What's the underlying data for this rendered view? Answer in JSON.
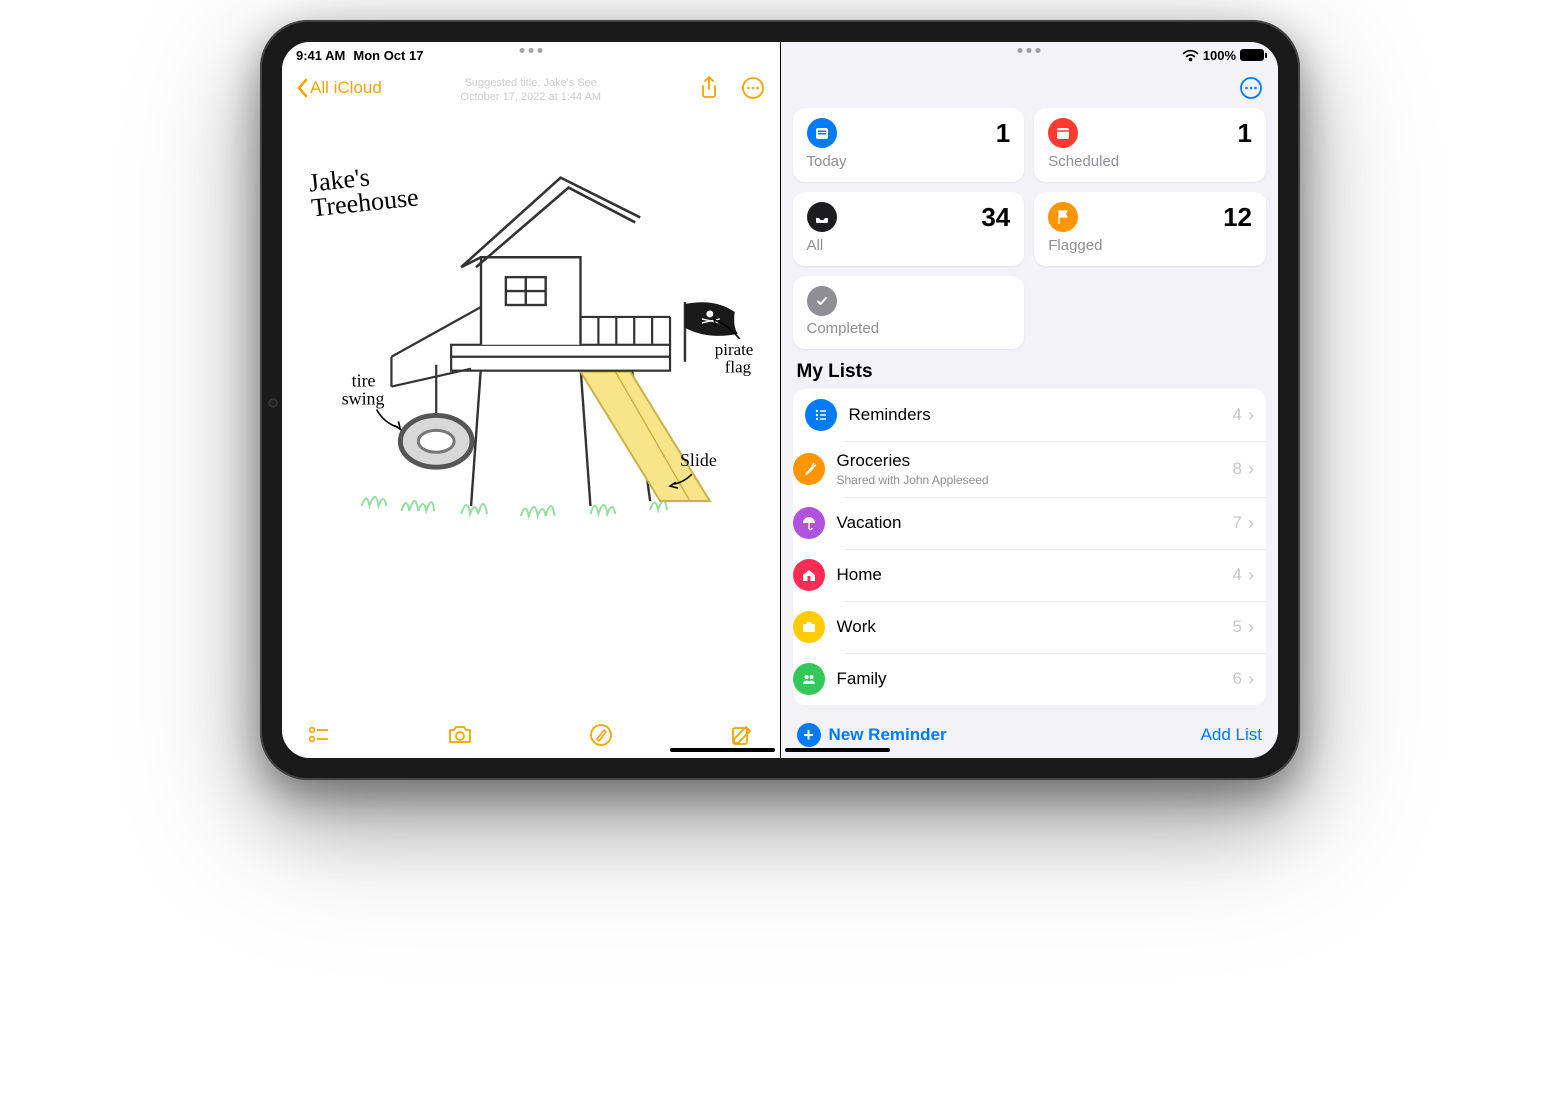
{
  "status": {
    "time": "9:41 AM",
    "date": "Mon Oct 17",
    "battery_pct": "100%"
  },
  "notes": {
    "back_label": "All iCloud",
    "suggested_line1": "Suggested title: Jake's  See",
    "suggested_line2": "October 17, 2022 at 1:44 AM",
    "sketch_title_line1": "Jake's",
    "sketch_title_line2": "Treehouse",
    "label_tire_swing": "tire\nswing",
    "label_pirate_flag": "pirate\nflag",
    "label_slide": "Slide"
  },
  "reminders": {
    "cards": {
      "today": {
        "label": "Today",
        "count": "1",
        "color": "#007aff"
      },
      "scheduled": {
        "label": "Scheduled",
        "count": "1",
        "color": "#ff3b30"
      },
      "all": {
        "label": "All",
        "count": "34",
        "color": "#1c1c1e"
      },
      "flagged": {
        "label": "Flagged",
        "count": "12",
        "color": "#ff9500"
      },
      "completed": {
        "label": "Completed",
        "count": "",
        "color": "#8e8e93"
      }
    },
    "my_lists_title": "My Lists",
    "lists": [
      {
        "name": "Reminders",
        "sub": "",
        "count": "4",
        "color": "#007aff",
        "icon": "list"
      },
      {
        "name": "Groceries",
        "sub": "Shared with John Appleseed",
        "count": "8",
        "color": "#ff9500",
        "icon": "carrot"
      },
      {
        "name": "Vacation",
        "sub": "",
        "count": "7",
        "color": "#af52de",
        "icon": "umbrella"
      },
      {
        "name": "Home",
        "sub": "",
        "count": "4",
        "color": "#ff2d55",
        "icon": "house"
      },
      {
        "name": "Work",
        "sub": "",
        "count": "5",
        "color": "#ffcc00",
        "icon": "briefcase"
      },
      {
        "name": "Family",
        "sub": "",
        "count": "6",
        "color": "#34c759",
        "icon": "people"
      }
    ],
    "new_reminder_label": "New Reminder",
    "add_list_label": "Add List"
  }
}
